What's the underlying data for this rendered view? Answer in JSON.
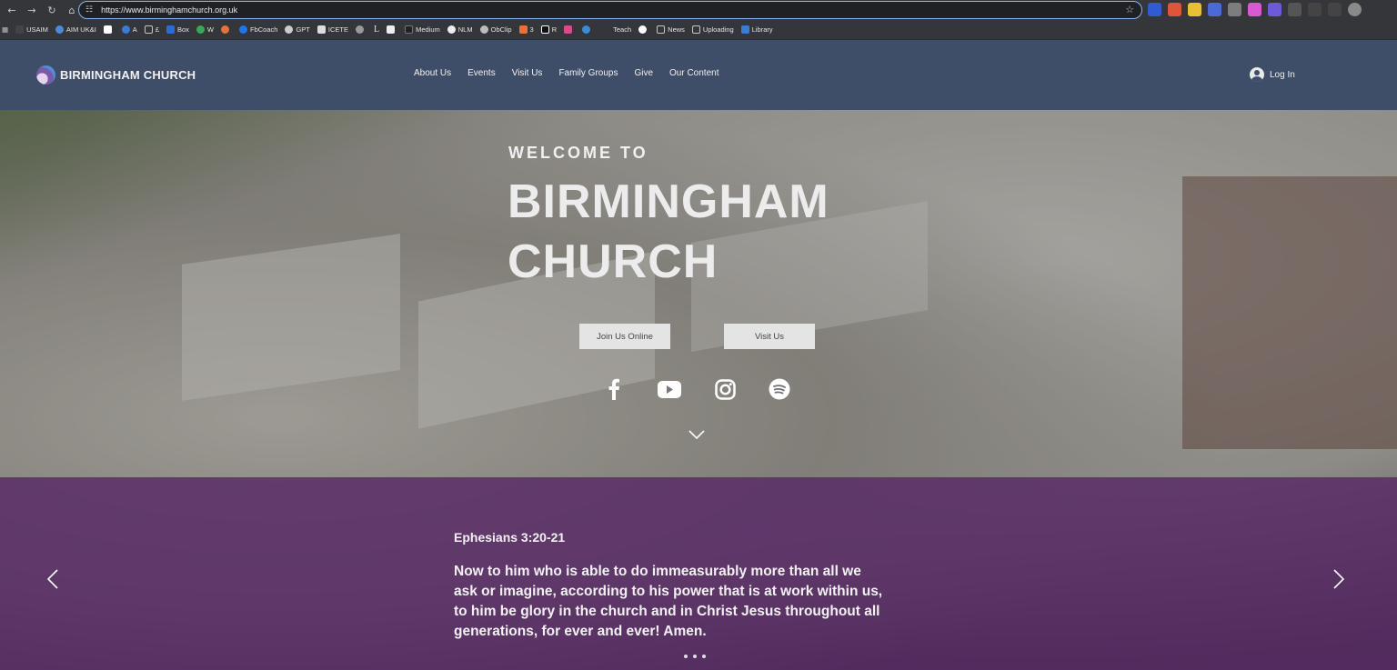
{
  "browser": {
    "url": "https://www.birminghamchurch.org.uk",
    "bookmarks": [
      "USAIM",
      "AIM UK&I",
      "",
      "A",
      "£",
      "Box",
      "W",
      "",
      "FbCoach",
      "GPT",
      "ICETE",
      "",
      "L",
      "",
      "Medium",
      "NLM",
      "ObClip",
      "3",
      "R",
      "",
      "",
      "Teach",
      "",
      "News",
      "Uploading",
      "Library"
    ]
  },
  "header": {
    "logo_text": "BIRMINGHAM CHURCH",
    "menu": [
      "About Us",
      "Events",
      "Visit Us",
      "Family Groups",
      "Give",
      "Our Content"
    ],
    "login": "Log In"
  },
  "hero": {
    "welcome": "WELCOME TO",
    "title_line1": "BIRMINGHAM",
    "title_line2": "CHURCH",
    "btn_join": "Join Us Online",
    "btn_visit": "Visit Us",
    "social_icons": [
      "facebook-icon",
      "youtube-icon",
      "instagram-icon",
      "spotify-icon"
    ]
  },
  "slider": {
    "reference": "Ephesians 3:20-21",
    "verse_lines": [
      "Now to him who is able to do immeasurably more than all we",
      "ask or imagine, according to his power that is at work within us,",
      "to him be glory in the church and in Christ Jesus throughout all",
      "generations, for ever and ever! Amen."
    ],
    "dots_count": 3
  },
  "colors": {
    "header_bg": "#3e4d68",
    "purple_band": "#582866",
    "button_bg": "#e4e4e4"
  }
}
